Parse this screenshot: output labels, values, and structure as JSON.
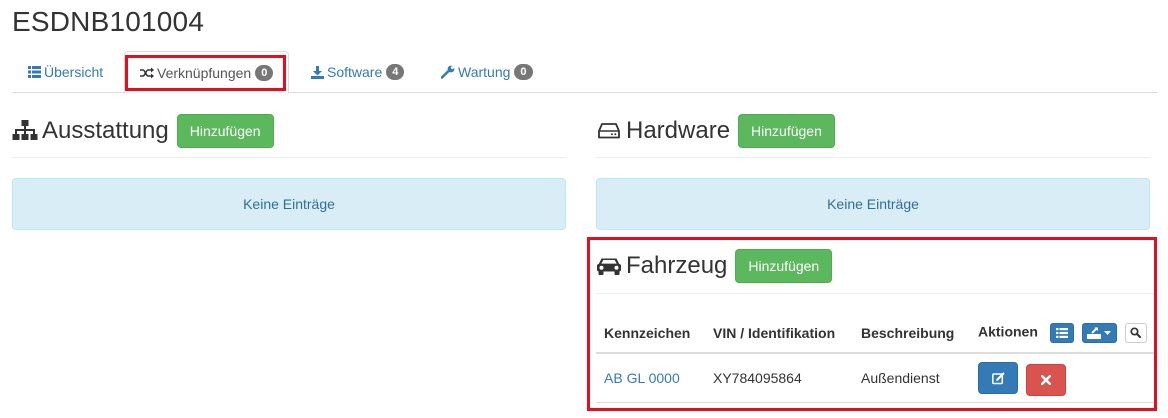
{
  "page": {
    "title": "ESDNB101004"
  },
  "tabs": [
    {
      "label": "Übersicht",
      "icon": "list-icon",
      "badge": null
    },
    {
      "label": "Verknüpfungen",
      "icon": "shuffle-icon",
      "badge": "0"
    },
    {
      "label": "Software",
      "icon": "download-icon",
      "badge": "4"
    },
    {
      "label": "Wartung",
      "icon": "wrench-icon",
      "badge": "0"
    }
  ],
  "active_tab": "Verknüpfungen",
  "sections": {
    "ausstattung": {
      "title": "Ausstattung",
      "icon": "sitemap-icon",
      "add_label": "Hinzufügen",
      "empty_text": "Keine Einträge"
    },
    "hardware": {
      "title": "Hardware",
      "icon": "hdd-icon",
      "add_label": "Hinzufügen",
      "empty_text": "Keine Einträge"
    },
    "fahrzeug": {
      "title": "Fahrzeug",
      "icon": "car-icon",
      "add_label": "Hinzufügen",
      "table": {
        "columns": [
          "Kennzeichen",
          "VIN / Identifikation",
          "Beschreibung",
          "Aktionen"
        ],
        "rows": [
          {
            "kennzeichen": "AB GL 0000",
            "vin": "XY784095864",
            "beschreibung": "Außendienst"
          }
        ]
      }
    }
  },
  "colors": {
    "success": "#5cb85c",
    "primary": "#337ab7",
    "danger": "#d9534f",
    "info_bg": "#d9edf7",
    "highlight": "#e01020"
  }
}
